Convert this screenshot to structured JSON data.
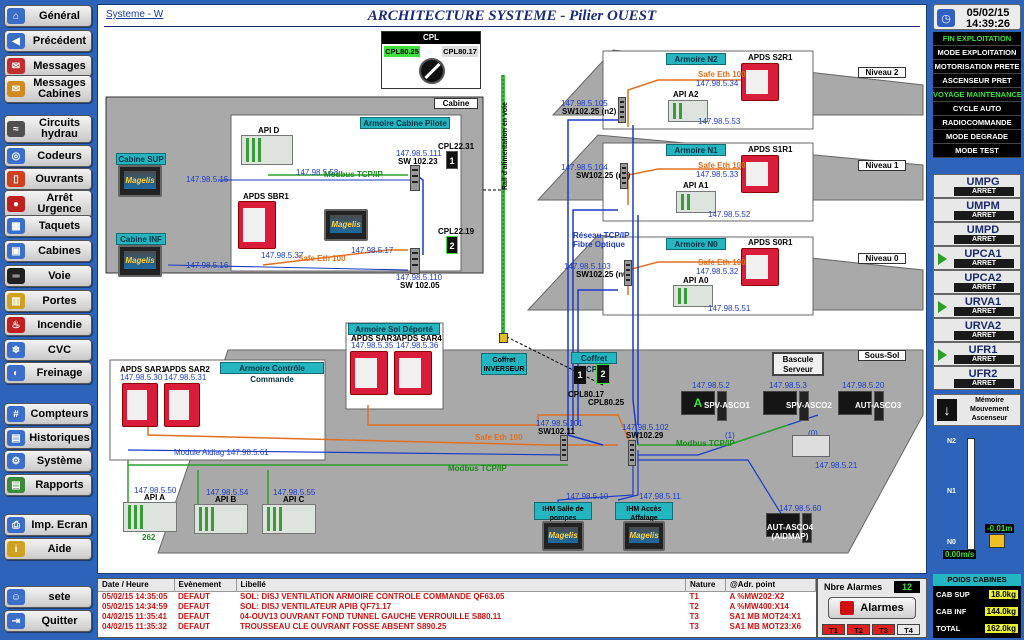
{
  "nav": {
    "items": [
      {
        "label": "Général",
        "icon": "home-icon",
        "color": "#3a6ec8"
      },
      {
        "label": "Précédent",
        "icon": "back-arrow-icon",
        "color": "#3a6ec8"
      },
      {
        "label": "Messages",
        "icon": "messages-icon",
        "color": "#c03030"
      },
      {
        "label": "Messages Cabines",
        "icon": "cabin-messages-icon",
        "color": "#d08a20"
      },
      {
        "label": "Circuits hydrau",
        "icon": "hydraulic-icon",
        "color": "#505050"
      },
      {
        "label": "Codeurs",
        "icon": "encoder-icon",
        "color": "#3a6ec8"
      },
      {
        "label": "Ouvrants",
        "icon": "door-icon",
        "color": "#d04020"
      },
      {
        "label": "Arrêt Urgence",
        "icon": "emergency-stop-icon",
        "color": "#c02020"
      },
      {
        "label": "Taquets",
        "icon": "latch-icon",
        "color": "#3a6ec8"
      },
      {
        "label": "Cabines",
        "icon": "cabin-icon",
        "color": "#3a6ec8"
      },
      {
        "label": "Voie",
        "icon": "track-icon",
        "color": "#202020"
      },
      {
        "label": "Portes",
        "icon": "gate-icon",
        "color": "#d0a020"
      },
      {
        "label": "Incendie",
        "icon": "fire-icon",
        "color": "#c02020"
      },
      {
        "label": "CVC",
        "icon": "hvac-icon",
        "color": "#3a6ec8"
      },
      {
        "label": "Freinage",
        "icon": "brake-icon",
        "color": "#3a6ec8"
      },
      {
        "label": "Compteurs",
        "icon": "counter-icon",
        "color": "#3a6ec8"
      },
      {
        "label": "Historiques",
        "icon": "history-icon",
        "color": "#3a6ec8"
      },
      {
        "label": "Système",
        "icon": "system-icon",
        "color": "#3a6ec8"
      },
      {
        "label": "Rapports",
        "icon": "report-icon",
        "color": "#3a8a3a"
      },
      {
        "label": "Imp. Ecran",
        "icon": "print-icon",
        "color": "#3a6ec8"
      },
      {
        "label": "Aide",
        "icon": "help-icon",
        "color": "#d0a020"
      },
      {
        "label": "sete",
        "icon": "user-icon",
        "color": "#3a6ec8"
      },
      {
        "label": "Quitter",
        "icon": "exit-icon",
        "color": "#3a6ec8"
      }
    ]
  },
  "header": {
    "link": "Systeme - W",
    "title": "ARCHITECTURE SYSTEME - Pilier OUEST"
  },
  "diagram": {
    "cpl": {
      "title": "CPL",
      "left": "CPL80.25",
      "right": "CPL80.17"
    },
    "levels": [
      "Niveau 2",
      "Niveau 1",
      "Niveau 0",
      "Sous-Sol",
      "Cabine"
    ],
    "armoires": {
      "n2": {
        "title": "Armoire N2",
        "apds": "APDS S2R1",
        "api": "API A2",
        "ip_apds": "147.98.5.34",
        "ip_api": "147.98.5.53",
        "safe": "Safe Eth 100",
        "sw_ip": "147.98.5.105",
        "sw": "SW102.25 (n2)"
      },
      "n1": {
        "title": "Armoire N1",
        "apds": "APDS S1R1",
        "api": "API A1",
        "ip_apds": "147.98.5.33",
        "ip_api": "147.98.5.52",
        "safe": "Safe Eth 100",
        "sw_ip": "147.98.5.104",
        "sw": "SW102.25 (n1)"
      },
      "n0": {
        "title": "Armoire N0",
        "apds": "APDS S0R1",
        "api": "API A0",
        "ip_apds": "147.98.5.32",
        "ip_api": "147.98.5.51",
        "safe": "Safe Eth 100",
        "sw_ip": "147.98.5.103",
        "sw": "SW102.25 (n0)"
      }
    },
    "reseau": "Réseau TCP/IP Fibre Optique",
    "rail": "Rail d'alimentation en voie",
    "coffret_inv": "Coffret INVERSEUR",
    "cabine": {
      "title": "Armoire Cabine Pilote",
      "api": "API D",
      "apds": "APDS SBR1",
      "cab_sup": "Cabine SUP",
      "cab_inf": "Cabine INF",
      "ip_sup": "147.98.5.15",
      "ip_inf": "147.98.5.16",
      "ip_apds": "147.98.5.37",
      "ip_api": "147.98.5.58",
      "ip_mag": "147.98.5.17",
      "sw1_ip": "147.98.5.111",
      "sw1": "SW 102.23",
      "sw2_ip": "147.98.5.110",
      "sw2": "SW 102.05",
      "cpl1": "CPL22.31",
      "cpl2": "CPL22.19",
      "modbus": "Modbus TCP/IP",
      "safe": "Safe Eth 100"
    },
    "soussol": {
      "title": "Armoire Contrôle Commande",
      "sol_title": "Armoire Sol Déporté",
      "apds1": "APDS SAR1",
      "apds2": "APDS SAR2",
      "apds3": "APDS SAR3",
      "apds4": "APDS SAR4",
      "ip1": "147.98.5.30",
      "ip2": "147.98.5.31",
      "ip3": "147.98.5.35",
      "ip4": "147.98.5.36",
      "coffret_cpl": "Coffret CPL",
      "cpl1": "CPL80.17",
      "cpl2": "CPL80.25",
      "bascule": "Bascule Serveur",
      "spv1": "SPV-ASCO1",
      "spv2": "SPV-ASCO2",
      "aut3": "AUT-ASCO3",
      "aut4": "AUT-ASCO4 (AIDMAP)",
      "ip_spv1": "147.98.5.2",
      "ip_spv2": "147.98.5.3",
      "ip_aut3": "147.98.5.20",
      "ip_aut4": "147.98.5.60",
      "ip_printer": "147.98.5.21",
      "sw1_ip": "147.98.5.101",
      "sw1": "SW102.11",
      "sw2_ip": "147.98.5.102",
      "sw2": "SW102.29",
      "modbus1": "Modbus TCP/IP",
      "modbus2": "Modbus TCP/IP",
      "safe": "Safe Eth 100",
      "aidiag": "Module Aidiag 147.98.5.61",
      "api_a": "API A",
      "api_b": "API B",
      "api_c": "API C",
      "ip_a": "147.98.5.50",
      "ip_b": "147.98.5.54",
      "ip_c": "147.98.5.55",
      "a_num": "262",
      "ihm1": "IHM Salle de pompes",
      "ihm2": "IHM Accès Affalage",
      "ip_ihm1": "147.98.5.10",
      "ip_ihm2": "147.98.5.11",
      "spv1_sub": "(1)",
      "spv2_sub": "(0)"
    }
  },
  "right": {
    "date": "05/02/15",
    "time": "14:39:26",
    "modes": [
      {
        "label": "FIN EXPLOITATION",
        "active": true
      },
      {
        "label": "MODE EXPLOITATION",
        "active": false
      },
      {
        "label": "MOTORISATION PRETE",
        "active": false
      },
      {
        "label": "ASCENSEUR PRET",
        "active": false
      },
      {
        "label": "VOYAGE MAINTENANCE",
        "active": true
      },
      {
        "label": "CYCLE AUTO",
        "active": false
      },
      {
        "label": "RADIOCOMMANDE",
        "active": false
      },
      {
        "label": "MODE DEGRADE",
        "active": false
      },
      {
        "label": "MODE TEST",
        "active": false
      }
    ],
    "lifts": [
      {
        "name": "UMPG",
        "state": "ARRET",
        "arrow": false
      },
      {
        "name": "UMPM",
        "state": "ARRET",
        "arrow": false
      },
      {
        "name": "UMPD",
        "state": "ARRET",
        "arrow": false
      },
      {
        "name": "UPCA1",
        "state": "ARRET",
        "arrow": true
      },
      {
        "name": "UPCA2",
        "state": "ARRET",
        "arrow": false
      },
      {
        "name": "URVA1",
        "state": "ARRET",
        "arrow": true
      },
      {
        "name": "URVA2",
        "state": "ARRET",
        "arrow": false
      },
      {
        "name": "UFR1",
        "state": "ARRET",
        "arrow": true
      },
      {
        "name": "UFR2",
        "state": "ARRET",
        "arrow": false
      }
    ],
    "memoire": "Mémoire Mouvement Ascenseur",
    "shaft": {
      "n2": "N2",
      "n1": "N1",
      "n0": "N0",
      "pos": "-0.01m",
      "speed": "0.00m/s"
    },
    "poids": {
      "title": "POIDS CABINES",
      "rows": [
        {
          "label": "CAB SUP",
          "val": "18.0kg"
        },
        {
          "label": "CAB INF",
          "val": "144.0kg"
        },
        {
          "label": "TOTAL",
          "val": "162.0kg"
        }
      ]
    }
  },
  "alarms": {
    "headers": [
      "Date / Heure",
      "Evènement",
      "Libellé",
      "Nature",
      "@Adr. point"
    ],
    "rows": [
      {
        "date": "05/02/15 14:35:05",
        "ev": "DEFAUT",
        "lib": "SOL: DISJ VENTILATION ARMOIRE CONTROLE COMMANDE QF63.05",
        "nat": "T1",
        "adr": "A %MW202:X2"
      },
      {
        "date": "05/02/15 14:34:59",
        "ev": "DEFAUT",
        "lib": "SOL: DISJ VENTILATEUR APIB QF71.17",
        "nat": "T2",
        "adr": "A %MW400:X14"
      },
      {
        "date": "04/02/15 11:35:41",
        "ev": "DEFAUT",
        "lib": "04-OUV13 OUVRANT FOND TUNNEL GAUCHE VERROUILLE S880.11",
        "nat": "T3",
        "adr": "SA1 MB MOT24:X1"
      },
      {
        "date": "04/02/15 11:35:32",
        "ev": "DEFAUT",
        "lib": "TROUSSEAU CLE OUVRANT FOSSE ABSENT S890.25",
        "nat": "T3",
        "adr": "SA1 MB MOT23:X6"
      }
    ],
    "count_label": "Nbre Alarmes",
    "count": "12",
    "button": "Alarmes",
    "toggles": [
      "T1",
      "T2",
      "T3",
      "T4"
    ]
  }
}
